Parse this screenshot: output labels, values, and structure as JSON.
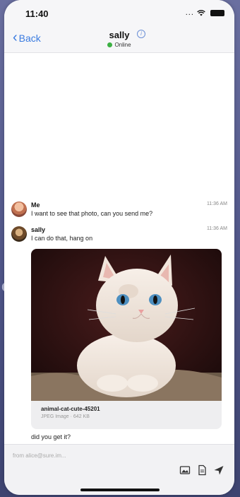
{
  "status": {
    "time": "11:40",
    "signal": "...",
    "wifi": "wifi"
  },
  "nav": {
    "back_label": "Back",
    "title": "sally",
    "presence": "Online"
  },
  "messages": [
    {
      "sender": "Me",
      "time": "11:36 AM",
      "text": "I want to see that photo, can you send me?"
    },
    {
      "sender": "sally",
      "time": "11:36 AM",
      "text": "I can do that, hang on"
    }
  ],
  "attachment": {
    "name": "animal-cat-cute-45201",
    "meta": "JPEG Image · 642 KB"
  },
  "followup": "did you get it?",
  "composer": {
    "placeholder": "from alice@sure.im..."
  },
  "icons": [
    "chevron-left-icon",
    "info-icon",
    "image-icon",
    "file-icon",
    "send-icon"
  ],
  "colors": {
    "accent": "#3a7be0",
    "online": "#3cb043"
  }
}
